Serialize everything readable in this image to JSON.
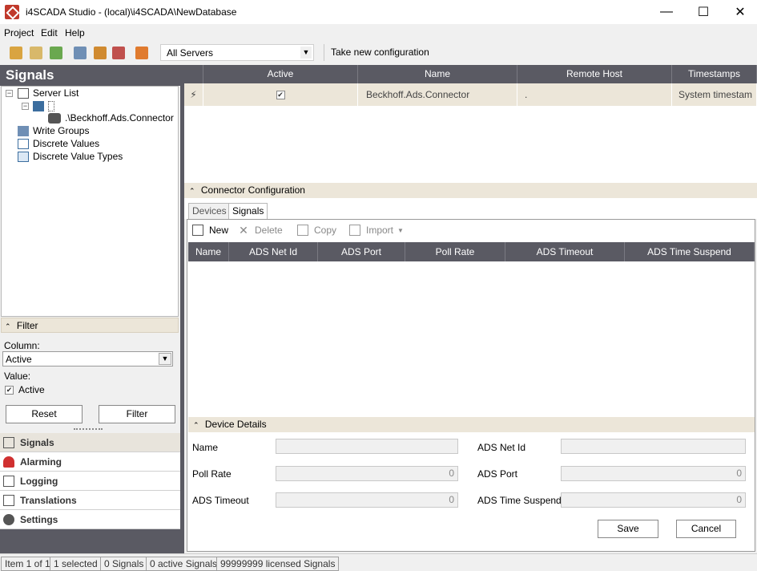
{
  "window": {
    "title": "i4SCADA Studio - (local)\\i4SCADA\\NewDatabase",
    "minimize": "—",
    "maximize": "☐",
    "close": "✕"
  },
  "menu": {
    "items": [
      "Project",
      "Edit",
      "Help"
    ]
  },
  "toolbar": {
    "server_select": "All Servers",
    "take_config": "Take new configuration"
  },
  "left_panel": {
    "title": "Signals",
    "tree": {
      "server_list": "Server List",
      "connector": ".\\Beckhoff.Ads.Connector",
      "write_groups": "Write Groups",
      "discrete_values": "Discrete Values",
      "discrete_value_types": "Discrete Value Types"
    },
    "filter": {
      "title": "Filter",
      "column_label": "Column:",
      "column_value": "Active",
      "value_label": "Value:",
      "value_checkbox": "Active",
      "reset": "Reset",
      "filter": "Filter"
    },
    "nav": [
      "Signals",
      "Alarming",
      "Logging",
      "Translations",
      "Settings"
    ]
  },
  "servers_table": {
    "headers": [
      "Active",
      "Name",
      "Remote Host",
      "Timestamps"
    ],
    "rows": [
      {
        "active": "✔",
        "name": "Beckhoff.Ads.Connector",
        "remote_host": ".",
        "timestamps": "System timestam"
      }
    ]
  },
  "connector_config": {
    "title": "Connector Configuration",
    "tabs": [
      "Devices",
      "Signals"
    ],
    "toolbar": {
      "new": "New",
      "delete": "Delete",
      "copy": "Copy",
      "import": "Import"
    },
    "device_headers": [
      "Name",
      "ADS Net Id",
      "ADS Port",
      "Poll Rate",
      "ADS Timeout",
      "ADS Time Suspend"
    ]
  },
  "device_details": {
    "title": "Device Details",
    "fields": {
      "name": {
        "label": "Name",
        "value": ""
      },
      "ads_net_id": {
        "label": "ADS Net Id",
        "value": ""
      },
      "poll_rate": {
        "label": "Poll Rate",
        "value": "0"
      },
      "ads_port": {
        "label": "ADS Port",
        "value": "0"
      },
      "ads_timeout": {
        "label": "ADS Timeout",
        "value": "0"
      },
      "ads_time_suspend": {
        "label": "ADS Time Suspend",
        "value": "0"
      }
    },
    "save": "Save",
    "cancel": "Cancel"
  },
  "status": {
    "items": [
      "Item 1 of 1",
      "1 selected",
      "0 Signals",
      "0 active Signals",
      "99999999 licensed Signals"
    ]
  },
  "colors": {
    "header_dark": "#5a5a63",
    "section_beige": "#ece6d9",
    "brand_red": "#c0392b"
  }
}
